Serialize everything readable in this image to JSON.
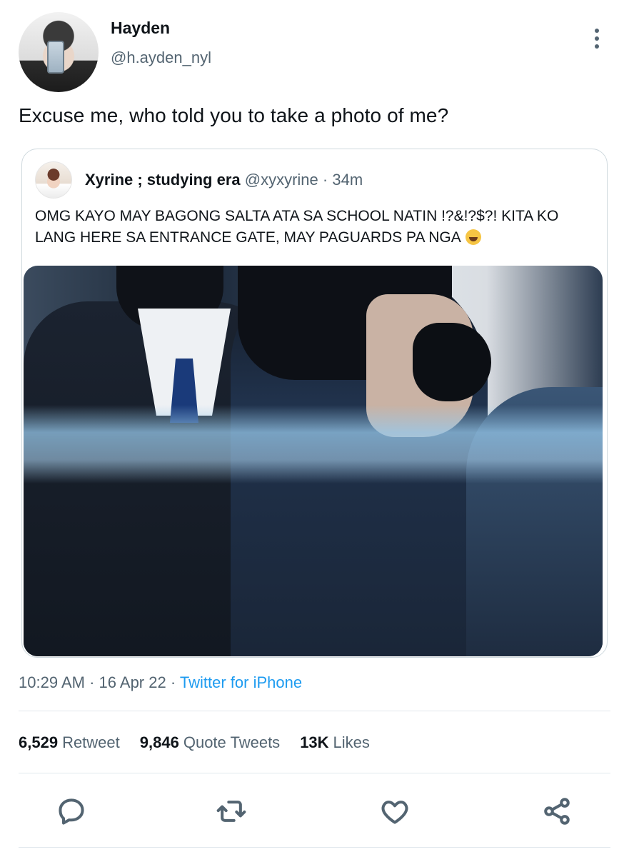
{
  "author": {
    "display_name": "Hayden",
    "handle": "@h.ayden_nyl",
    "avatar_icon": "profile-photo"
  },
  "tweet": {
    "text": "Excuse me, who told you to take a photo of me?"
  },
  "quoted_tweet": {
    "display_name": "Xyrine ; studying era",
    "handle": "@xyxyrine",
    "separator": "·",
    "time": "34m",
    "text": "OMG KAYO MAY BAGONG SALTA ATA SA SCHOOL NATIN !?&!?$?! KITA KO LANG HERE SA ENTRANCE GATE, MAY PAGUARDS PA NGA",
    "emoji": "grinning-sweat-face",
    "media_icon": "photo"
  },
  "meta": {
    "time": "10:29 AM",
    "sep1": "·",
    "date": "16 Apr 22",
    "sep2": "·",
    "source": "Twitter for iPhone"
  },
  "stats": {
    "retweets_num": "6,529",
    "retweets_label": "Retweet",
    "quotes_num": "9,846",
    "quotes_label": "Quote Tweets",
    "likes_num": "13K",
    "likes_label": "Likes"
  },
  "actions": {
    "reply_icon": "reply-icon",
    "retweet_icon": "retweet-icon",
    "like_icon": "heart-icon",
    "share_icon": "share-icon"
  },
  "colors": {
    "text_primary": "#0f1419",
    "text_secondary": "#536471",
    "link": "#1d9bf0",
    "border": "#cfd9de"
  }
}
